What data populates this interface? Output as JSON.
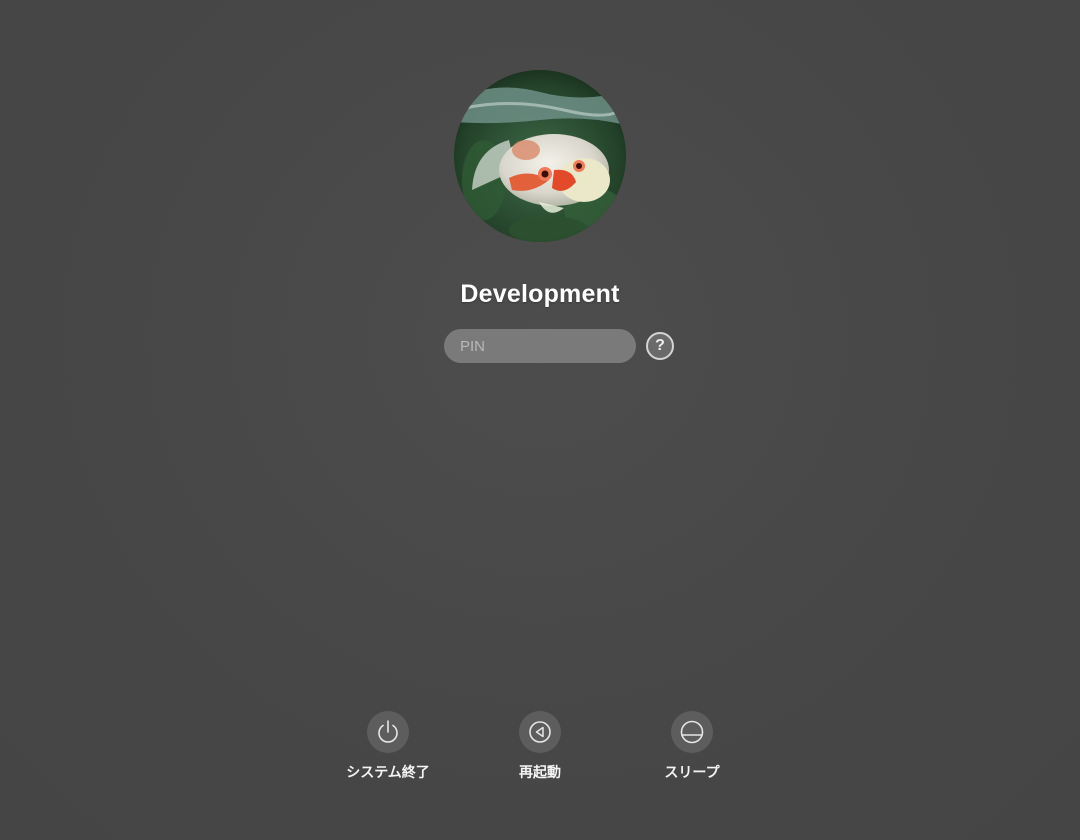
{
  "user": {
    "name": "Development",
    "avatar_icon": "goldfish-photo"
  },
  "login": {
    "pin_placeholder": "PIN",
    "pin_value": "",
    "help_label": "?",
    "help_icon": "question-mark-icon"
  },
  "actions": [
    {
      "id": "shutdown",
      "label": "システム終了",
      "icon": "power-icon"
    },
    {
      "id": "restart",
      "label": "再起動",
      "icon": "restart-triangle-icon"
    },
    {
      "id": "sleep",
      "label": "スリープ",
      "icon": "sleep-half-circle-icon"
    }
  ],
  "colors": {
    "background": "#474747",
    "field": "#7a7a7a",
    "action_circle": "#5d5d5d",
    "text": "#ffffff"
  }
}
